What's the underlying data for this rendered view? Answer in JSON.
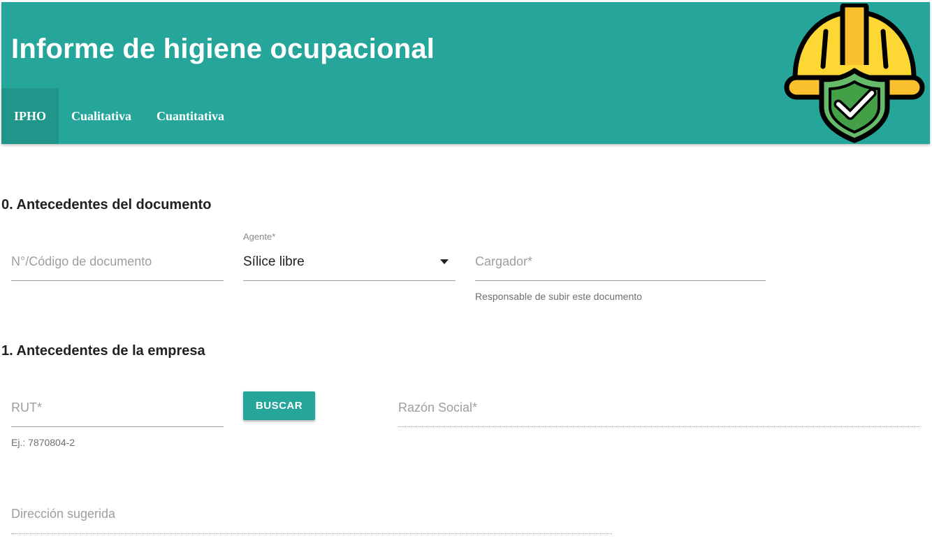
{
  "header": {
    "title": "Informe de higiene ocupacional",
    "tabs": [
      {
        "label": "IPHO",
        "active": true
      },
      {
        "label": "Cualitativa",
        "active": false
      },
      {
        "label": "Cuantitativa",
        "active": false
      }
    ],
    "logo_icon": "hard-hat-shield-check-icon",
    "colors": {
      "primary": "#26a69a",
      "active_tab": "#20958a",
      "helmet": "#fdd835",
      "shield": "#66bb6a"
    }
  },
  "section0": {
    "title": "0. Antecedentes del documento",
    "document_code": {
      "placeholder": "N°/Código de documento",
      "value": ""
    },
    "agent": {
      "label": "Agente*",
      "value": "Sílice libre",
      "icon": "caret-down-icon"
    },
    "uploader": {
      "placeholder": "Cargador*",
      "helper": "Responsable de subir este documento",
      "value": ""
    }
  },
  "section1": {
    "title": "1. Antecedentes de la empresa",
    "rut": {
      "placeholder": "RUT*",
      "helper": "Ej.: 7870804-2",
      "value": ""
    },
    "search_button": "BUSCAR",
    "business_name": {
      "placeholder": "Razón Social*",
      "value": ""
    },
    "suggested_address": {
      "placeholder": "Dirección sugerida",
      "value": ""
    }
  }
}
